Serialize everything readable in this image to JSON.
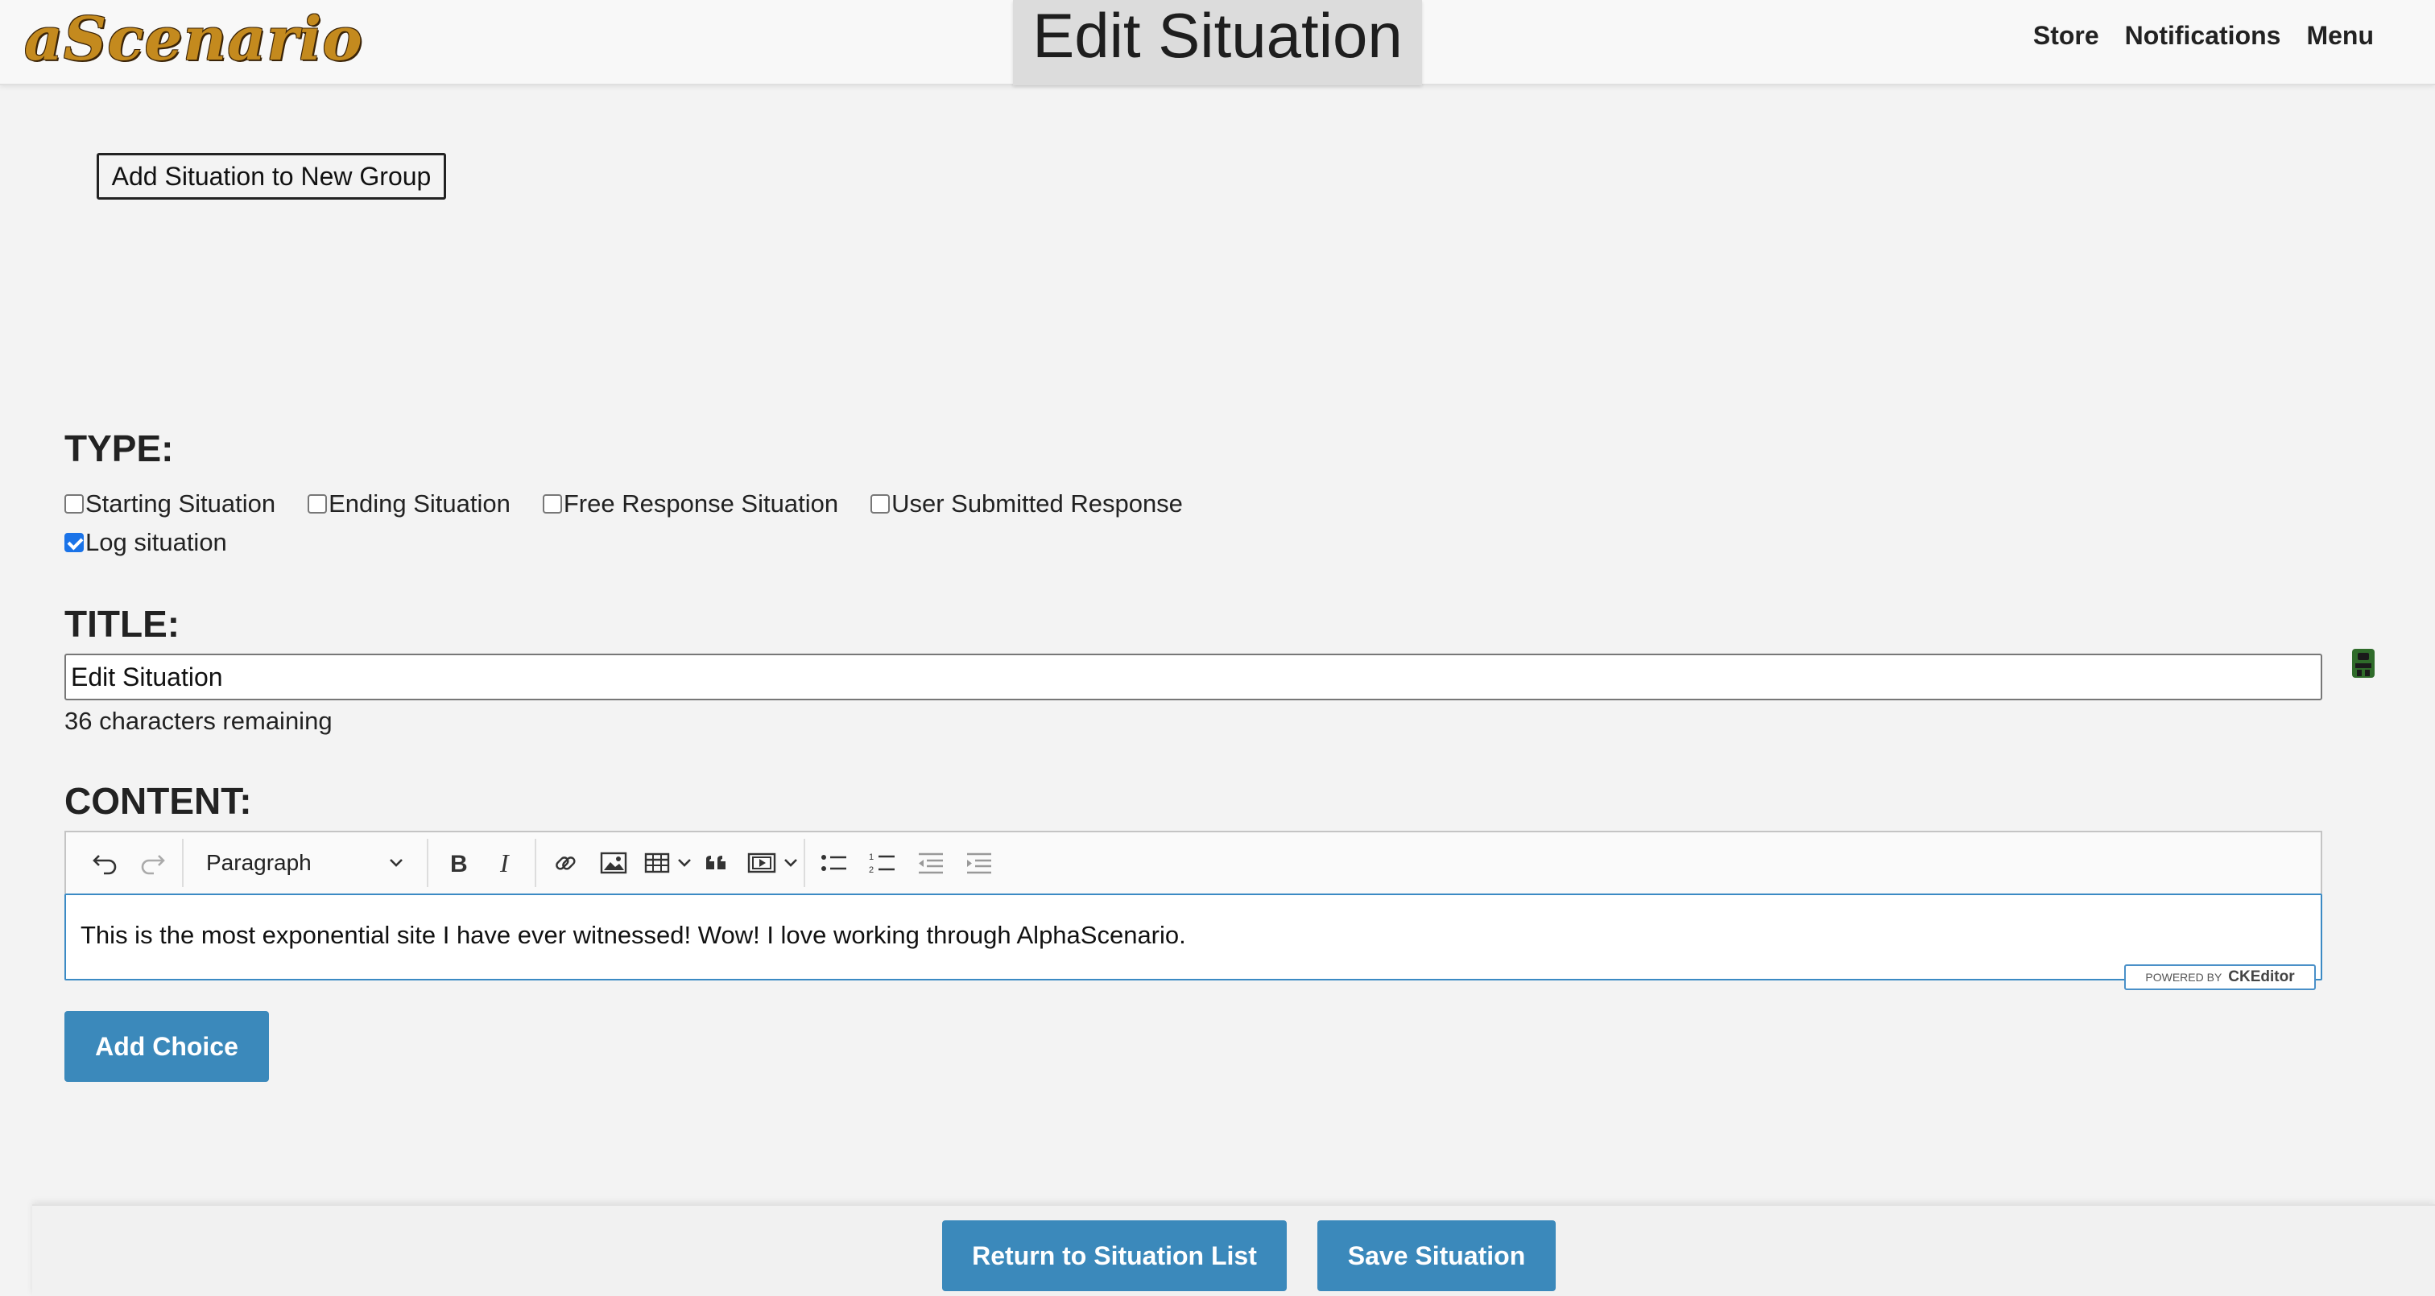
{
  "header": {
    "logo_text": "aScenario",
    "page_title": "Edit Situation",
    "nav": [
      "Store",
      "Notifications",
      "Menu"
    ]
  },
  "group_button_label": "Add Situation to New Group",
  "type_section": {
    "label": "TYPE:",
    "options": [
      {
        "label": "Starting Situation",
        "checked": false
      },
      {
        "label": "Ending Situation",
        "checked": false
      },
      {
        "label": "Free Response Situation",
        "checked": false
      },
      {
        "label": "User Submitted Response",
        "checked": false
      },
      {
        "label": "Log situation",
        "checked": true
      }
    ]
  },
  "title_section": {
    "label": "TITLE:",
    "value": "Edit Situation",
    "remaining_text": "36 characters remaining"
  },
  "content_section": {
    "label": "CONTENT:",
    "block_format": "Paragraph",
    "text": "This is the most exponential site I have ever witnessed! Wow! I love working through AlphaScenario.",
    "powered_by": "POWERED BY",
    "powered_brand": "CKEditor"
  },
  "add_choice_label": "Add Choice",
  "footer": {
    "return_label": "Return to Situation List",
    "save_label": "Save Situation"
  },
  "colors": {
    "accent": "#3b89bb",
    "background": "#f3f3f3",
    "checkbox_checked": "#1a73e8"
  },
  "icons": [
    "undo-icon",
    "redo-icon",
    "bold-icon",
    "italic-icon",
    "link-icon",
    "image-icon",
    "table-icon",
    "blockquote-icon",
    "media-icon",
    "bulleted-list-icon",
    "numbered-list-icon",
    "outdent-icon",
    "indent-icon",
    "voice-input-icon"
  ]
}
